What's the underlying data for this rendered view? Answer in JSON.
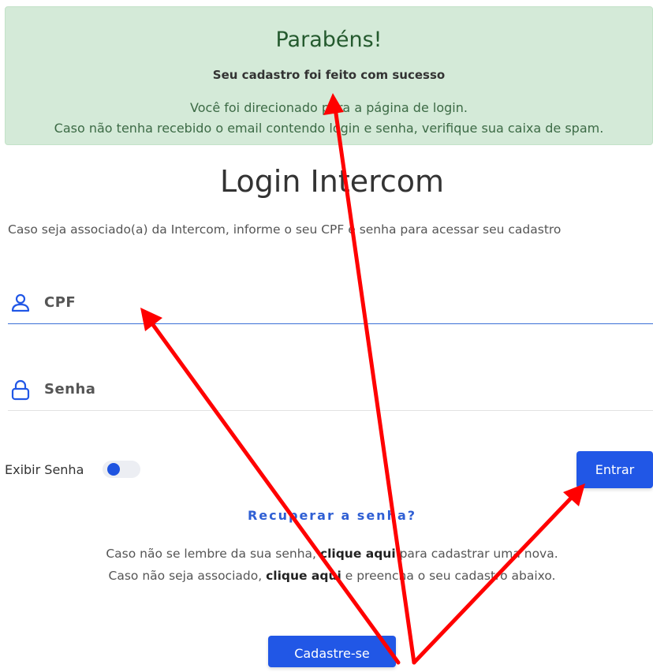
{
  "alert": {
    "title": "Parabéns!",
    "subtitle": "Seu cadastro foi feito com sucesso",
    "line1": "Você foi direcionado para a página de login.",
    "line2": "Caso não tenha recebido o email contendo login e senha, verifique sua caixa de spam."
  },
  "login": {
    "title": "Login Intercom",
    "subtitle": "Caso seja associado(a) da Intercom, informe o seu CPF e senha para acessar seu cadastro",
    "cpf_placeholder": "CPF",
    "senha_placeholder": "Senha",
    "show_password_label": "Exibir Senha",
    "show_password_on": false,
    "enter_button": "Entrar",
    "recover_link": "Recuperar a senha?",
    "info1_pre": "Caso não se lembre da sua senha, ",
    "info1_link": "clique aqui",
    "info1_post": " para cadastrar uma nova.",
    "info2_pre": "Caso não seja associado, ",
    "info2_link": "clique aqui",
    "info2_post": " e preencha o seu cadastro abaixo.",
    "register_button": "Cadastre-se"
  },
  "icons": {
    "cpf": "user-icon",
    "senha": "lock-icon"
  },
  "colors": {
    "primary": "#2157e6",
    "alert_bg": "#d4ead8",
    "annotation": "#ff0000"
  }
}
